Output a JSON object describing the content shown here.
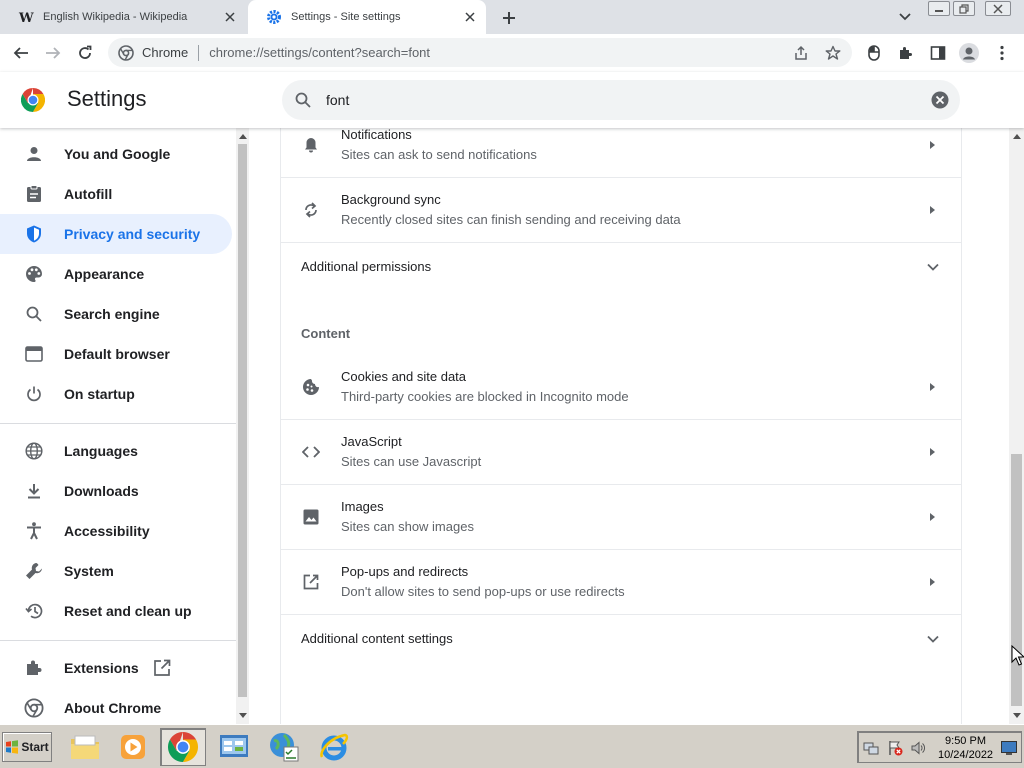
{
  "tabs": [
    {
      "title": "English Wikipedia - Wikipedia",
      "active": false
    },
    {
      "title": "Settings - Site settings",
      "active": true
    }
  ],
  "omnibox": {
    "chip": "Chrome",
    "url": "chrome://settings/content?search=font"
  },
  "header": {
    "title": "Settings",
    "search_value": "font"
  },
  "sidebar": {
    "items": [
      {
        "label": "You and Google",
        "icon": "person-icon"
      },
      {
        "label": "Autofill",
        "icon": "clipboard-icon"
      },
      {
        "label": "Privacy and security",
        "icon": "shield-icon",
        "active": true
      },
      {
        "label": "Appearance",
        "icon": "palette-icon"
      },
      {
        "label": "Search engine",
        "icon": "search-icon"
      },
      {
        "label": "Default browser",
        "icon": "browser-icon"
      },
      {
        "label": "On startup",
        "icon": "power-icon"
      },
      {
        "label": "Languages",
        "icon": "globe-icon"
      },
      {
        "label": "Downloads",
        "icon": "download-icon"
      },
      {
        "label": "Accessibility",
        "icon": "accessibility-icon"
      },
      {
        "label": "System",
        "icon": "wrench-icon"
      },
      {
        "label": "Reset and clean up",
        "icon": "restore-icon"
      },
      {
        "label": "Extensions",
        "icon": "puzzle-icon"
      },
      {
        "label": "About Chrome",
        "icon": "chrome-icon"
      }
    ]
  },
  "main": {
    "permissions_rows": [
      {
        "title": "Notifications",
        "subtitle": "Sites can ask to send notifications",
        "icon": "bell-icon"
      },
      {
        "title": "Background sync",
        "subtitle": "Recently closed sites can finish sending and receiving data",
        "icon": "sync-icon"
      }
    ],
    "additional_permissions": "Additional permissions",
    "content_heading": "Content",
    "content_rows": [
      {
        "title": "Cookies and site data",
        "subtitle": "Third-party cookies are blocked in Incognito mode",
        "icon": "cookie-icon"
      },
      {
        "title": "JavaScript",
        "subtitle": "Sites can use Javascript",
        "icon": "code-icon"
      },
      {
        "title": "Images",
        "subtitle": "Sites can show images",
        "icon": "image-icon"
      },
      {
        "title": "Pop-ups and redirects",
        "subtitle": "Don't allow sites to send pop-ups or use redirects",
        "icon": "popup-icon"
      }
    ],
    "additional_content": "Additional content settings"
  },
  "taskbar": {
    "start_label": "Start",
    "time": "9:50 PM",
    "date": "10/24/2022"
  },
  "colors": {
    "accent": "#1a73e8",
    "active_nav_bg": "#e8f0fe",
    "tabbar": "#dee1e6",
    "taskbar": "#d4d0c8"
  }
}
